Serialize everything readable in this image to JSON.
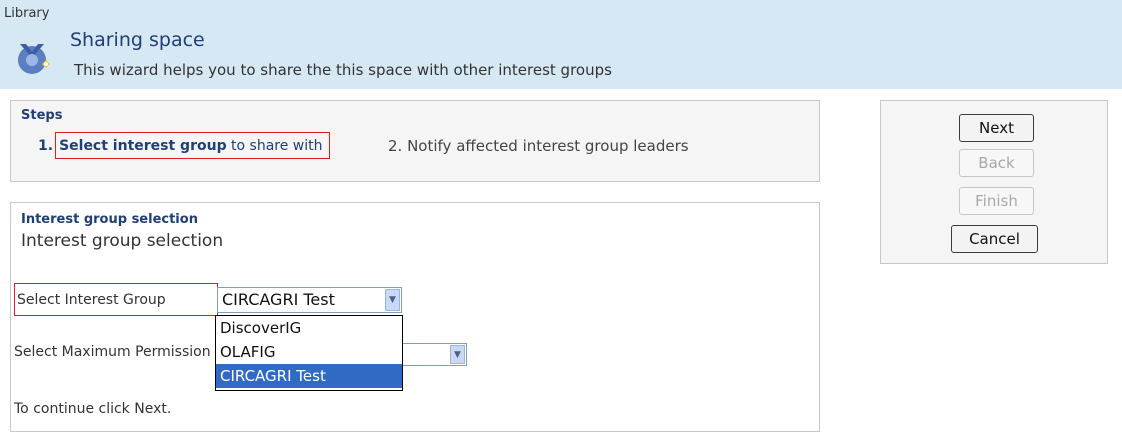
{
  "header": {
    "breadcrumb": "Library",
    "icon": "sharing-wizard-icon",
    "title": "Sharing space",
    "description": "This wizard helps you to share the this space with other interest groups"
  },
  "steps": {
    "heading": "Steps",
    "step1": {
      "number": "1.",
      "bold_text": "Select interest group",
      "rest_text": " to share with"
    },
    "step2": "2. Notify affected interest group leaders"
  },
  "actions": {
    "next": "Next",
    "back": "Back",
    "finish": "Finish",
    "cancel": "Cancel"
  },
  "selection": {
    "heading": "Interest group selection",
    "subtitle": "Interest group selection",
    "interest_group_label": "Select Interest Group",
    "interest_group_value": "CIRCAGRI Test",
    "interest_group_options": [
      "DiscoverIG",
      "OLAFIG",
      "CIRCAGRI Test"
    ],
    "permission_label": "Select Maximum Permission",
    "permission_value": "",
    "continue_text": "To continue click Next."
  }
}
